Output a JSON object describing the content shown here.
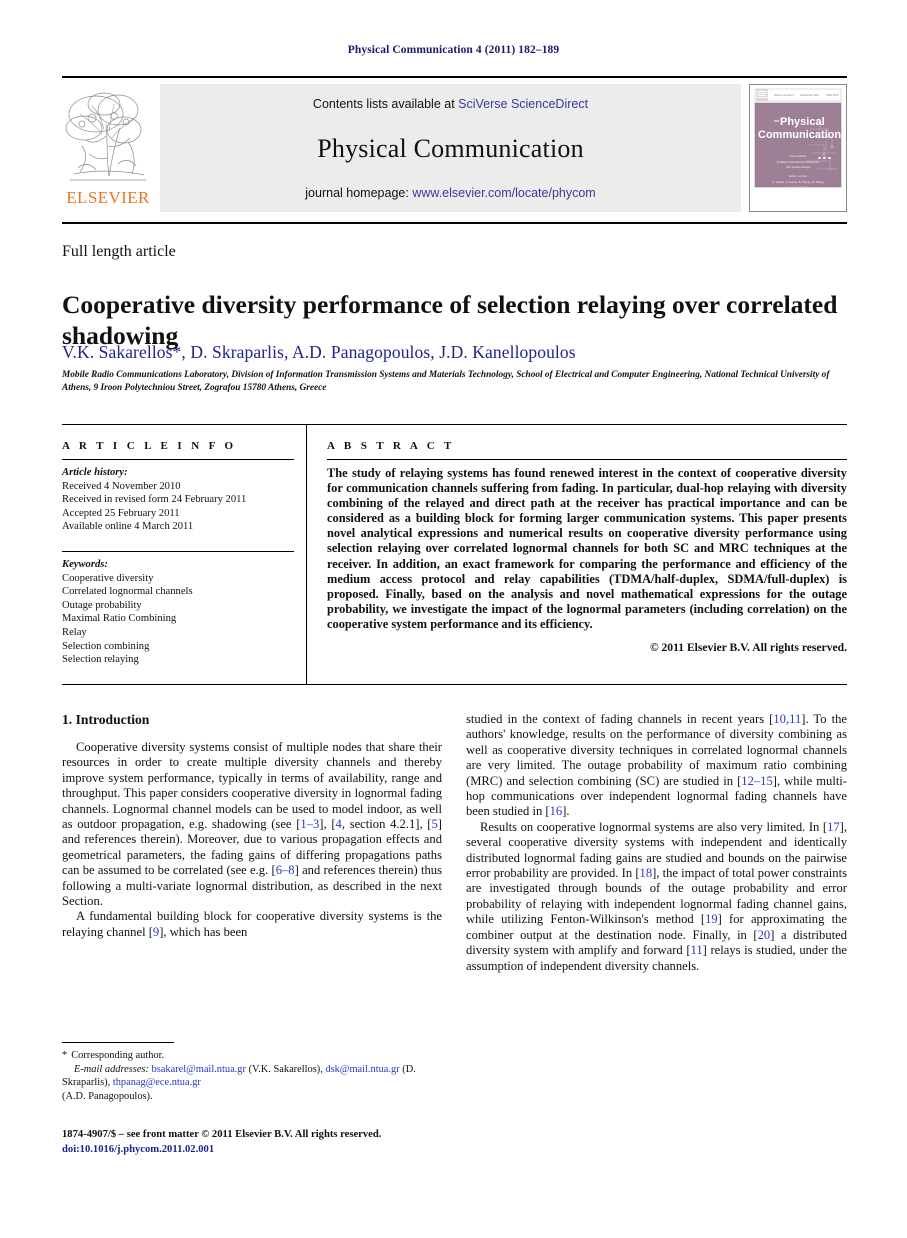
{
  "running_head": "Physical Communication 4 (2011) 182–189",
  "masthead": {
    "contents_prefix": "Contents lists available at ",
    "contents_link": "SciVerse ScienceDirect",
    "journal_title": "Physical Communication",
    "homepage_prefix": "journal homepage: ",
    "homepage_link": "www.elsevier.com/locate/phycom",
    "publisher_wordmark": "ELSEVIER",
    "cover_title_line1": "Physical",
    "cover_title_line2": "Communication"
  },
  "article": {
    "type": "Full length article",
    "title": "Cooperative diversity performance of selection relaying over correlated shadowing",
    "authors": "V.K. Sakarellos*, D. Skraparlis, A.D. Panagopoulos, J.D. Kanellopoulos",
    "affiliation": "Mobile Radio Communications Laboratory, Division of Information Transmission Systems and Materials Technology, School of Electrical and Computer Engineering, National Technical University of Athens, 9 Iroon Polytechniou Street, Zografou 15780 Athens, Greece"
  },
  "info": {
    "heading": "A R T I C L E    I N F O",
    "history_label": "Article history:",
    "history": [
      "Received 4 November 2010",
      "Received in revised form 24 February 2011",
      "Accepted 25 February 2011",
      "Available online 4 March 2011"
    ],
    "keywords_label": "Keywords:",
    "keywords": [
      "Cooperative diversity",
      "Correlated lognormal channels",
      "Outage probability",
      "Maximal Ratio Combining",
      "Relay",
      "Selection combining",
      "Selection relaying"
    ]
  },
  "abstract": {
    "heading": "A B S T R A C T",
    "text": "The study of relaying systems has found renewed interest in the context of cooperative diversity for communication channels suffering from fading. In particular, dual-hop relaying with diversity combining of the relayed and direct path at the receiver has practical importance and can be considered as a building block for forming larger communication systems. This paper presents novel analytical expressions and numerical results on cooperative diversity performance using selection relaying over correlated lognormal channels for both SC and MRC techniques at the receiver. In addition, an exact framework for comparing the performance and efficiency of the medium access protocol and relay capabilities (TDMA/half-duplex, SDMA/full-duplex) is proposed. Finally, based on the analysis and novel mathematical expressions for the outage probability, we investigate the impact of the lognormal parameters (including correlation) on the cooperative system performance and its efficiency.",
    "copyright": "© 2011 Elsevier B.V. All rights reserved."
  },
  "body": {
    "section_title": "1. Introduction",
    "left_paragraphs": [
      {
        "parts": [
          {
            "t": "Cooperative diversity systems consist of multiple nodes that share their resources in order to create multiple diversity channels and thereby improve system performance, typically in terms of availability, range and throughput. This paper considers cooperative diversity in lognormal fading channels. Lognormal channel models can be used to model indoor, as well as outdoor propagation, e.g. shadowing (see [",
            "k": "text"
          },
          {
            "t": "1–3",
            "k": "ref"
          },
          {
            "t": "], [",
            "k": "text"
          },
          {
            "t": "4",
            "k": "ref"
          },
          {
            "t": ", section 4.2.1], [",
            "k": "text"
          },
          {
            "t": "5",
            "k": "ref"
          },
          {
            "t": "] and references therein). Moreover, due to various propagation effects and geometrical parameters, the fading gains of differing propagations paths can be assumed to be correlated (see e.g. [",
            "k": "text"
          },
          {
            "t": "6–8",
            "k": "ref"
          },
          {
            "t": "] and references therein) thus following a multi-variate lognormal distribution, as described in the next Section.",
            "k": "text"
          }
        ]
      },
      {
        "parts": [
          {
            "t": "A fundamental building block for cooperative diversity systems is the relaying channel [",
            "k": "text"
          },
          {
            "t": "9",
            "k": "ref"
          },
          {
            "t": "], which has been",
            "k": "text"
          }
        ]
      }
    ],
    "right_paragraphs": [
      {
        "parts": [
          {
            "t": "studied in the context of fading channels in recent years [",
            "k": "text"
          },
          {
            "t": "10,11",
            "k": "ref"
          },
          {
            "t": "]. To the authors' knowledge, results on the performance of diversity combining as well as cooperative diversity techniques in correlated lognormal channels are very limited. The outage probability of maximum ratio combining (MRC) and selection combining (SC) are studied in [",
            "k": "text"
          },
          {
            "t": "12–15",
            "k": "ref"
          },
          {
            "t": "], while multi-hop communications over independent lognormal fading channels have been studied in [",
            "k": "text"
          },
          {
            "t": "16",
            "k": "ref"
          },
          {
            "t": "].",
            "k": "text"
          }
        ]
      },
      {
        "parts": [
          {
            "t": "Results on cooperative lognormal systems are also very limited. In [",
            "k": "text"
          },
          {
            "t": "17",
            "k": "ref"
          },
          {
            "t": "], several cooperative diversity systems with independent and identically distributed lognormal fading gains are studied and bounds on the pairwise error probability are provided. In [",
            "k": "text"
          },
          {
            "t": "18",
            "k": "ref"
          },
          {
            "t": "], the impact of total power constraints are investigated through bounds of the outage probability and error probability of relaying with independent lognormal fading channel gains, while utilizing Fenton-Wilkinson's method [",
            "k": "text"
          },
          {
            "t": "19",
            "k": "ref"
          },
          {
            "t": "] for approximating the combiner output at the destination node. Finally, in [",
            "k": "text"
          },
          {
            "t": "20",
            "k": "ref"
          },
          {
            "t": "] a distributed diversity system with amplify and forward [",
            "k": "text"
          },
          {
            "t": "11",
            "k": "ref"
          },
          {
            "t": "] relays is studied, under the assumption of independent diversity channels.",
            "k": "text"
          }
        ]
      }
    ]
  },
  "footnote": {
    "star": "*",
    "corresponding": "Corresponding author.",
    "email_label": "E-mail addresses:",
    "emails": [
      {
        "address": "bsakarel@mail.ntua.gr",
        "owner": "(V.K. Sakarellos),"
      },
      {
        "address": "dsk@mail.ntua.gr",
        "owner": "(D. Skraparlis),"
      },
      {
        "address": "thpanag@ece.ntua.gr",
        "owner": ""
      }
    ],
    "last_owner": "(A.D. Panagopoulos)."
  },
  "imprint": {
    "line1": "1874-4907/$ – see front matter © 2011 Elsevier B.V. All rights reserved.",
    "doi": "doi:10.1016/j.phycom.2011.02.001"
  }
}
